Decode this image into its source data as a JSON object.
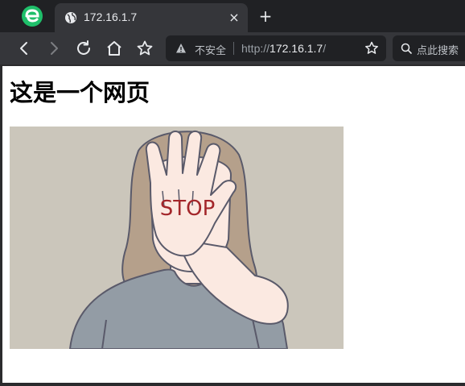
{
  "browser": {
    "tab": {
      "title": "172.16.1.7",
      "favicon": "globe-icon",
      "close": "×"
    },
    "new_tab": "+",
    "toolbar": {
      "security_label": "不安全",
      "url_scheme": "http://",
      "url_host": "172.16.1.7",
      "url_path": "/",
      "search_placeholder": "点此搜索"
    }
  },
  "page": {
    "heading": "这是一个网页",
    "image": {
      "hand_text": "STOP"
    }
  },
  "colors": {
    "tabbar": "#202124",
    "toolbar": "#35363a",
    "logo": "#1fbf6a",
    "stop_text": "#a3262a",
    "image_bg": "#cbc6bb"
  }
}
